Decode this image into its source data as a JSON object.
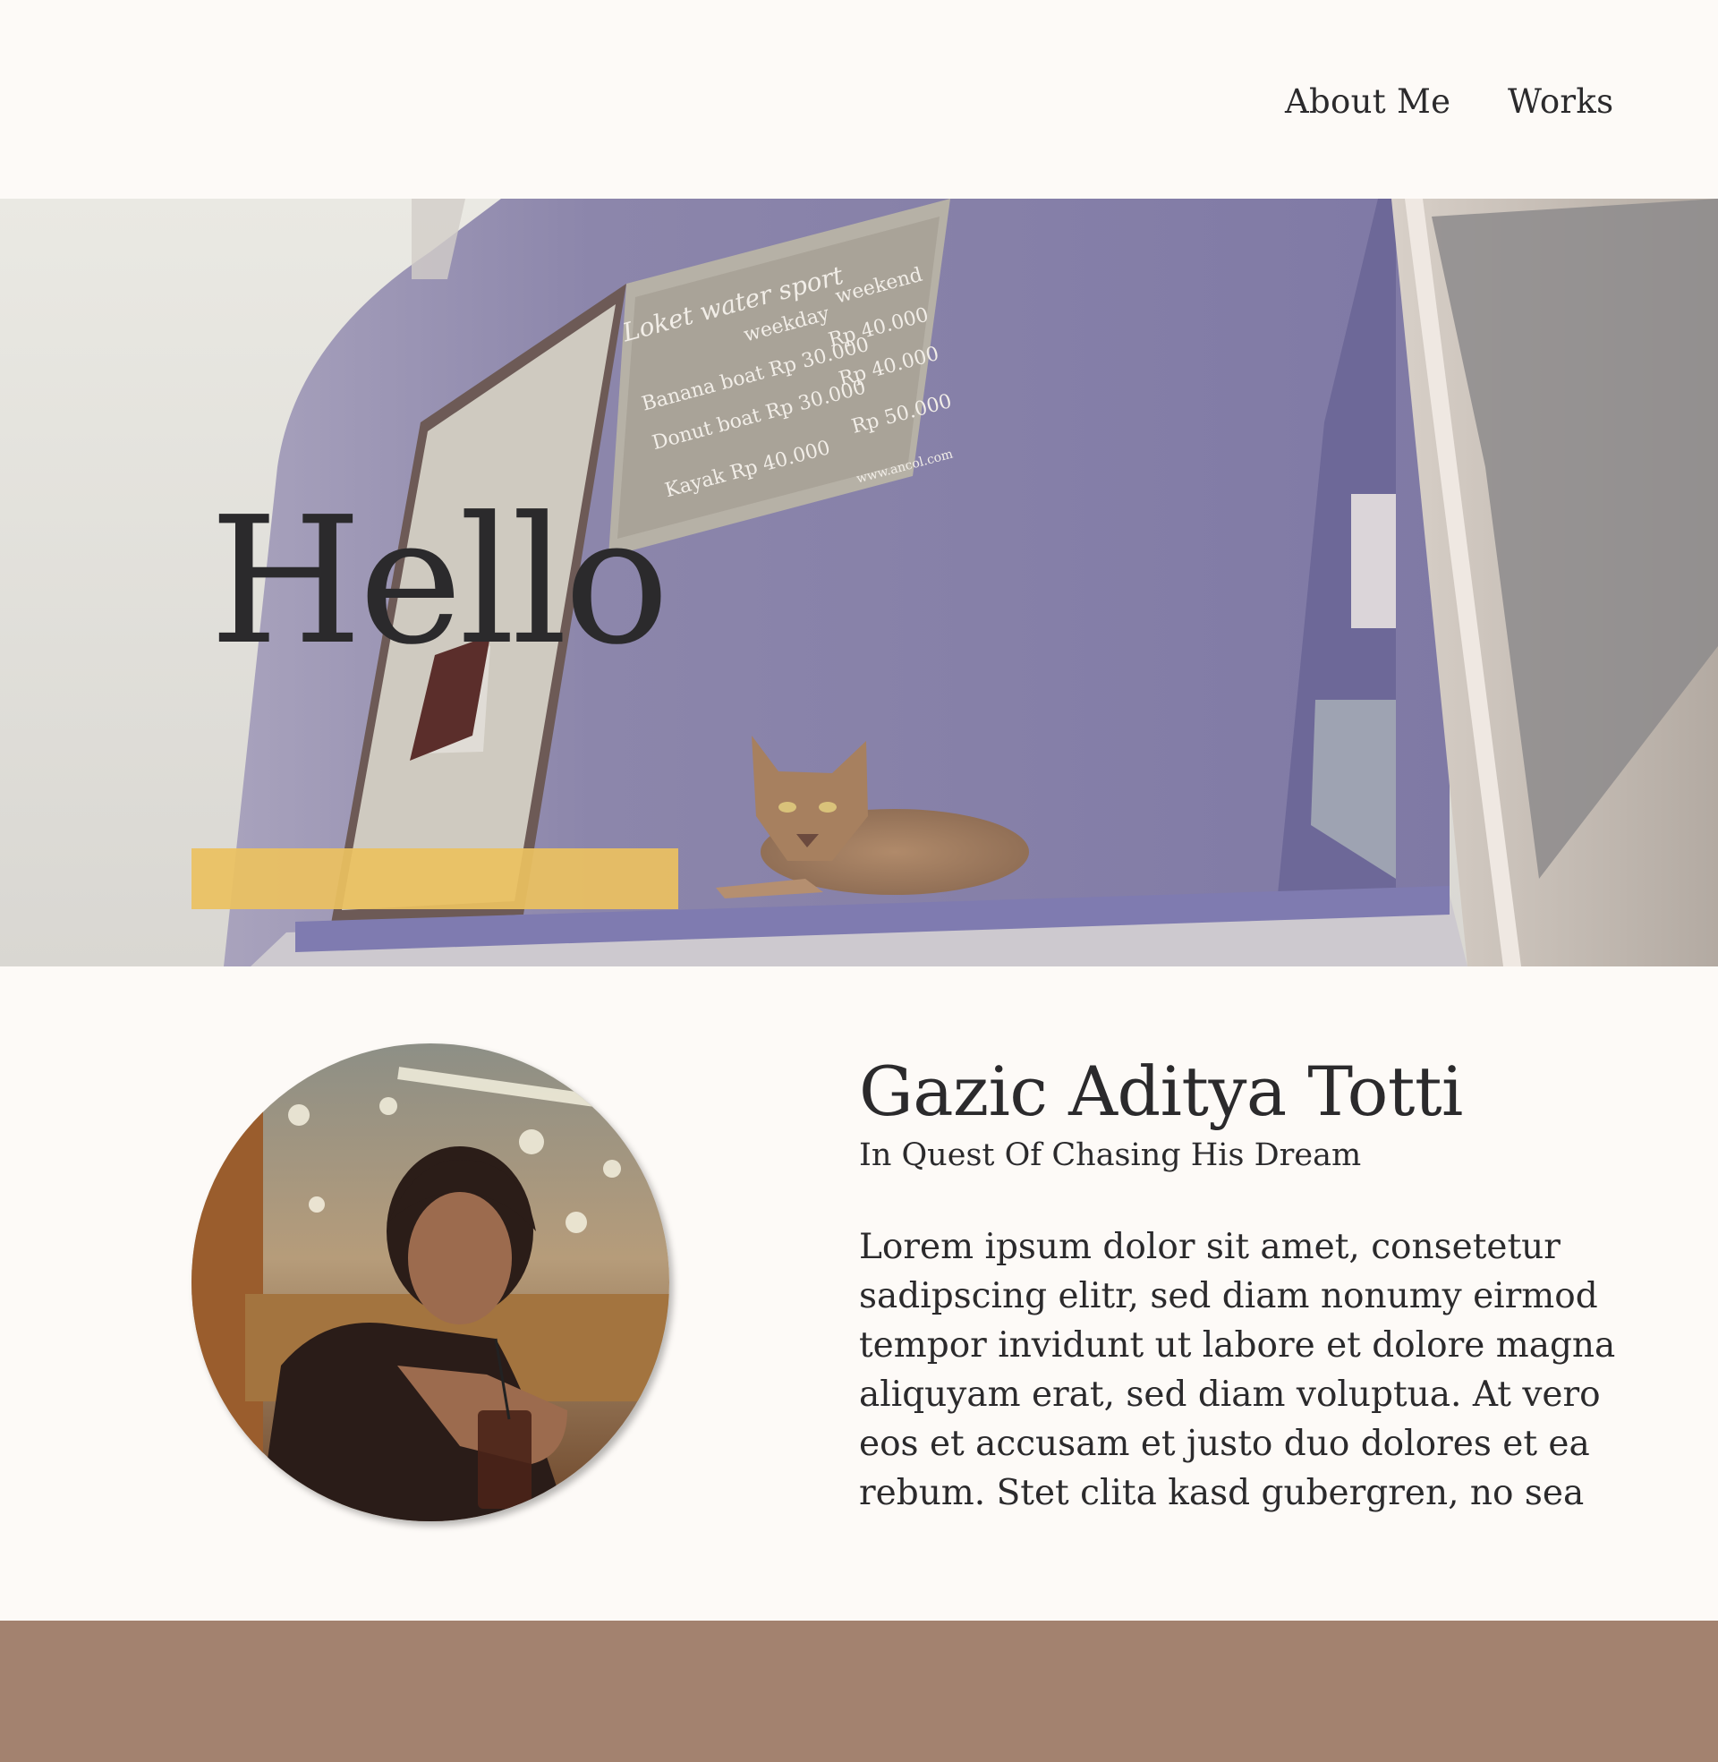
{
  "nav": {
    "about_label": "About Me",
    "works_label": "Works"
  },
  "hero": {
    "title": "Hello",
    "highlight_color": "#ebc160",
    "photo_sign": {
      "heading": "Loket water sport",
      "col1": "weekday",
      "col2": "weekend",
      "rows": [
        {
          "label": "Banana boat Rp 30.000",
          "weekend": "Rp 40.000"
        },
        {
          "label": "Donut boat Rp 30.000",
          "weekend": "Rp 40.000"
        },
        {
          "label": "Kayak Rp 40.000",
          "weekend": "Rp 50.000"
        }
      ],
      "website": "www.ancol.com"
    }
  },
  "about": {
    "name": "Gazic Aditya Totti",
    "tagline": "In Quest Of Chasing His Dream",
    "body": "Lorem ipsum dolor sit amet, consetetur sadipscing elitr, sed diam nonumy eirmod tempor invidunt ut labore et dolore magna aliquyam erat, sed diam voluptua. At vero eos et accusam et justo duo dolores et ea rebum. Stet clita kasd gubergren, no sea"
  },
  "footer": {
    "color": "#a3826f"
  }
}
